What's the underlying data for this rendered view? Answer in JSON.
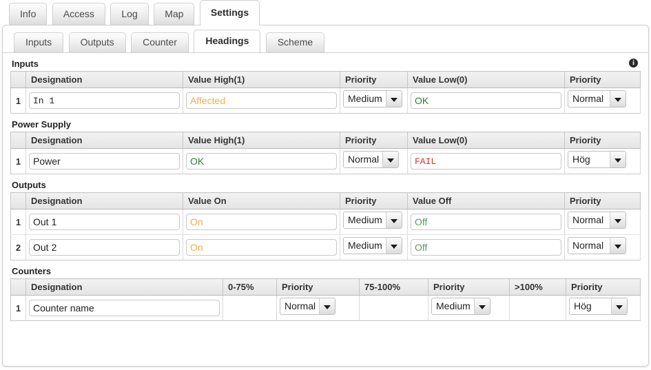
{
  "outer_tabs": [
    {
      "label": "Info",
      "active": false
    },
    {
      "label": "Access",
      "active": false
    },
    {
      "label": "Log",
      "active": false
    },
    {
      "label": "Map",
      "active": false
    },
    {
      "label": "Settings",
      "active": true
    }
  ],
  "inner_tabs": [
    {
      "label": "Inputs",
      "active": false
    },
    {
      "label": "Outputs",
      "active": false
    },
    {
      "label": "Counter",
      "active": false
    },
    {
      "label": "Headings",
      "active": true
    },
    {
      "label": "Scheme",
      "active": false
    }
  ],
  "icons": {
    "info": "i"
  },
  "sections": {
    "inputs": {
      "title": "Inputs",
      "has_info_icon": true,
      "headers": [
        "",
        "Designation",
        "Value High(1)",
        "Priority",
        "Value Low(0)",
        "Priority"
      ],
      "rows": [
        {
          "num": "1",
          "designation": "In 1",
          "designation_placeholder": "",
          "value_high": "",
          "value_high_placeholder": "Affected",
          "priority_high": "Medium",
          "value_low": "OK",
          "value_low_placeholder": "",
          "priority_low": "Normal"
        }
      ]
    },
    "power_supply": {
      "title": "Power Supply",
      "has_info_icon": false,
      "headers": [
        "",
        "Designation",
        "Value High(1)",
        "Priority",
        "Value Low(0)",
        "Priority"
      ],
      "rows": [
        {
          "num": "1",
          "designation": "Power",
          "value_high": "OK",
          "priority_high": "Normal",
          "value_low": "FAIL",
          "priority_low": "Hög"
        }
      ]
    },
    "outputs": {
      "title": "Outputs",
      "has_info_icon": false,
      "headers": [
        "",
        "Designation",
        "Value On",
        "Priority",
        "Value Off",
        "Priority"
      ],
      "rows": [
        {
          "num": "1",
          "designation": "Out 1",
          "value_on": "",
          "value_on_placeholder": "On",
          "priority_on": "Medium",
          "value_off": "",
          "value_off_placeholder": "Off",
          "priority_off": "Normal"
        },
        {
          "num": "2",
          "designation": "Out 2",
          "value_on": "",
          "value_on_placeholder": "On",
          "priority_on": "Medium",
          "value_off": "",
          "value_off_placeholder": "Off",
          "priority_off": "Normal"
        }
      ]
    },
    "counters": {
      "title": "Counters",
      "has_info_icon": false,
      "headers": [
        "",
        "Designation",
        "0-75%",
        "Priority",
        "75-100%",
        "Priority",
        ">100%",
        "Priority"
      ],
      "rows": [
        {
          "num": "1",
          "designation": "Counter name",
          "range_low": "",
          "priority_low": "Normal",
          "range_mid": "",
          "priority_mid": "Medium",
          "range_high": "",
          "priority_high": "Hög"
        }
      ]
    }
  },
  "colors": {
    "ok_green": "#2e7d32",
    "fail_red": "#d32f2f",
    "affected_orange": "#f0ad4e",
    "panel_border": "#cfcfcf"
  }
}
